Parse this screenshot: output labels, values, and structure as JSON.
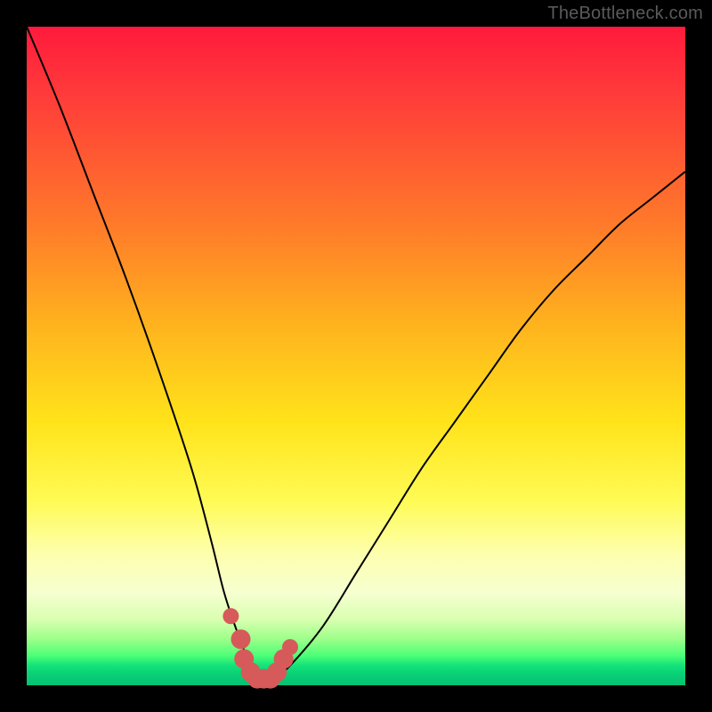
{
  "watermark": "TheBottleneck.com",
  "chart_data": {
    "type": "line",
    "title": "",
    "xlabel": "",
    "ylabel": "",
    "xlim": [
      0,
      100
    ],
    "ylim": [
      0,
      100
    ],
    "series": [
      {
        "name": "bottleneck-curve",
        "x": [
          0,
          5,
          10,
          15,
          20,
          25,
          28,
          30,
          32,
          34,
          35,
          36,
          37,
          38,
          40,
          45,
          50,
          55,
          60,
          65,
          70,
          75,
          80,
          85,
          90,
          95,
          100
        ],
        "values": [
          100,
          88,
          75,
          62,
          48,
          33,
          22,
          14,
          8,
          3,
          1.5,
          1,
          1,
          1.5,
          3,
          9,
          17,
          25,
          33,
          40,
          47,
          54,
          60,
          65,
          70,
          74,
          78
        ]
      }
    ],
    "markers": {
      "name": "highlight-dots",
      "color": "#d65a5a",
      "x": [
        31,
        32.5,
        33,
        34,
        35,
        36,
        37,
        38,
        39,
        40
      ],
      "values": [
        10.5,
        7,
        4,
        2,
        1,
        1,
        1,
        2,
        4,
        5.8
      ]
    }
  },
  "colors": {
    "curve": "#000000",
    "marker": "#d65a5a",
    "frame": "#000000"
  }
}
